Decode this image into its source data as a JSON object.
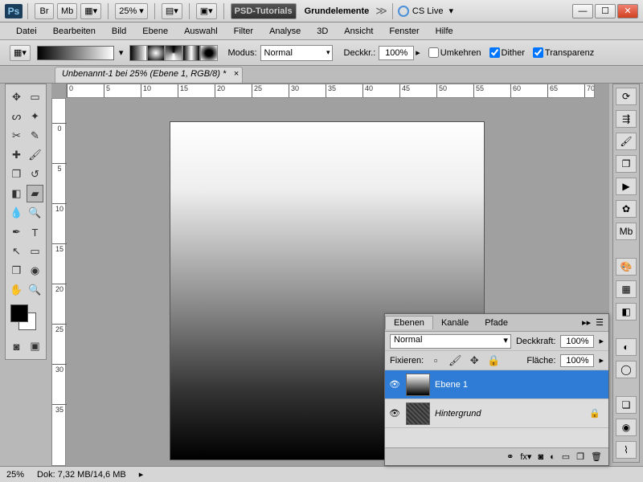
{
  "titlebar": {
    "zoom": "25%",
    "workspace_btn": "PSD-Tutorials",
    "workspace2": "Grundelemente",
    "cslive": "CS Live"
  },
  "menu": [
    "Datei",
    "Bearbeiten",
    "Bild",
    "Ebene",
    "Auswahl",
    "Filter",
    "Analyse",
    "3D",
    "Ansicht",
    "Fenster",
    "Hilfe"
  ],
  "opt": {
    "modus_label": "Modus:",
    "modus_value": "Normal",
    "deckkr_label": "Deckkr.:",
    "deckkr_value": "100%",
    "chk_umkehren": "Umkehren",
    "chk_dither": "Dither",
    "chk_transparenz": "Transparenz"
  },
  "doc": {
    "tab": "Unbenannt-1 bei 25% (Ebene 1, RGB/8) *"
  },
  "ruler_h": [
    "0",
    "5",
    "10",
    "15",
    "20",
    "25",
    "30",
    "35",
    "40",
    "45",
    "50",
    "55",
    "60",
    "65",
    "70"
  ],
  "ruler_v": [
    "0",
    "5",
    "10",
    "15",
    "20",
    "25",
    "30",
    "35"
  ],
  "layers": {
    "tabs": [
      "Ebenen",
      "Kanäle",
      "Pfade"
    ],
    "mode": "Normal",
    "deckkraft_label": "Deckkraft:",
    "deckkraft": "100%",
    "fix_label": "Fixieren:",
    "flaeche_label": "Fläche:",
    "flaeche": "100%",
    "items": [
      {
        "name": "Ebene 1",
        "active": true
      },
      {
        "name": "Hintergrund",
        "locked": true
      }
    ]
  },
  "status": {
    "zoom": "25%",
    "dok": "Dok: 7,32 MB/14,6 MB"
  }
}
